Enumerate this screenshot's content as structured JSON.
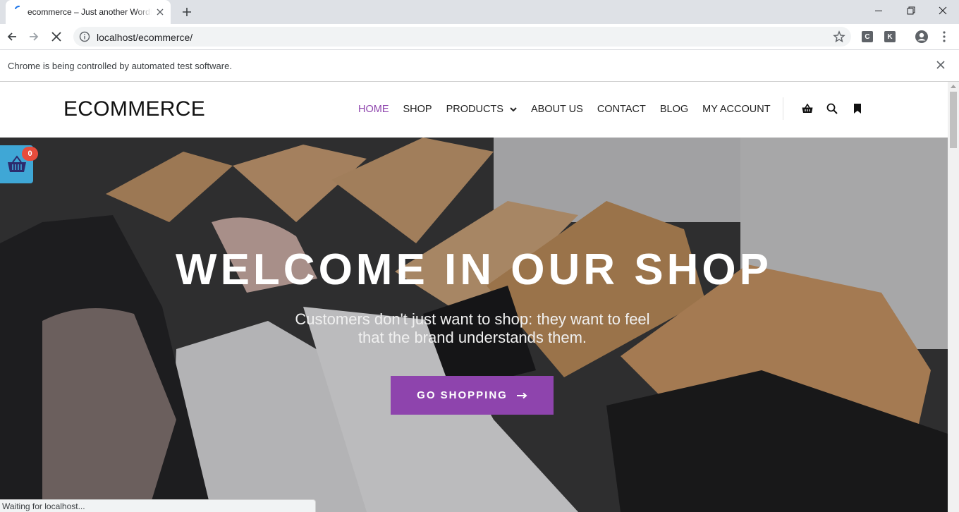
{
  "browser": {
    "tab_title": "ecommerce – Just another WordPress site",
    "url": "localhost/ecommerce/",
    "infobar_text": "Chrome is being controlled by automated test software.",
    "status_text": "Waiting for localhost...",
    "extensions": [
      "C",
      "K"
    ]
  },
  "site": {
    "title": "ECOMMERCE",
    "accent_color": "#8e44ad",
    "nav": [
      {
        "label": "HOME",
        "active": true
      },
      {
        "label": "SHOP"
      },
      {
        "label": "PRODUCTS",
        "dropdown": true
      },
      {
        "label": "ABOUT US"
      },
      {
        "label": "CONTACT"
      },
      {
        "label": "BLOG"
      },
      {
        "label": "MY ACCOUNT"
      }
    ],
    "header_icons": [
      "basket-icon",
      "search-icon",
      "bookmark-icon"
    ]
  },
  "hero": {
    "title": "WELCOME IN OUR SHOP",
    "subtitle": "Customers don't just want to shop: they want to feel that the brand understands them.",
    "button_label": "GO SHOPPING",
    "button_icon": "arrow-right-icon"
  },
  "floating_cart": {
    "count": "0",
    "icon": "shopping-basket-icon",
    "color": "#3fa7d6"
  }
}
